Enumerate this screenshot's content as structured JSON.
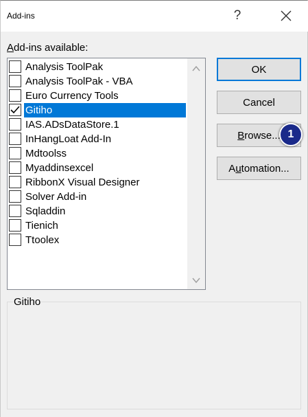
{
  "window": {
    "title": "Add-ins",
    "help_label": "?",
    "close_icon": "close-icon"
  },
  "list": {
    "label_accel": "A",
    "label_rest": "dd-ins available:",
    "items": [
      {
        "label": "Analysis ToolPak",
        "checked": false,
        "selected": false
      },
      {
        "label": "Analysis ToolPak - VBA",
        "checked": false,
        "selected": false
      },
      {
        "label": "Euro Currency Tools",
        "checked": false,
        "selected": false
      },
      {
        "label": "Gitiho",
        "checked": true,
        "selected": true
      },
      {
        "label": "IAS.ADsDataStore.1",
        "checked": false,
        "selected": false
      },
      {
        "label": "InHangLoat Add-In",
        "checked": false,
        "selected": false
      },
      {
        "label": "Mdtoolss",
        "checked": false,
        "selected": false
      },
      {
        "label": "Myaddinsexcel",
        "checked": false,
        "selected": false
      },
      {
        "label": "RibbonX Visual Designer",
        "checked": false,
        "selected": false
      },
      {
        "label": "Solver Add-in",
        "checked": false,
        "selected": false
      },
      {
        "label": "Sqladdin",
        "checked": false,
        "selected": false
      },
      {
        "label": "Tienich",
        "checked": false,
        "selected": false
      },
      {
        "label": "Ttoolex",
        "checked": false,
        "selected": false
      }
    ]
  },
  "buttons": {
    "ok": "OK",
    "cancel": "Cancel",
    "browse_accel": "B",
    "browse_rest": "rowse...",
    "automation_pre": "A",
    "automation_accel": "u",
    "automation_rest": "tomation..."
  },
  "badge": {
    "label": "1",
    "color": "#1a2a8a"
  },
  "description": {
    "title": "Gitiho"
  },
  "colors": {
    "selection": "#0078d7",
    "default_button_border": "#0078d7"
  }
}
